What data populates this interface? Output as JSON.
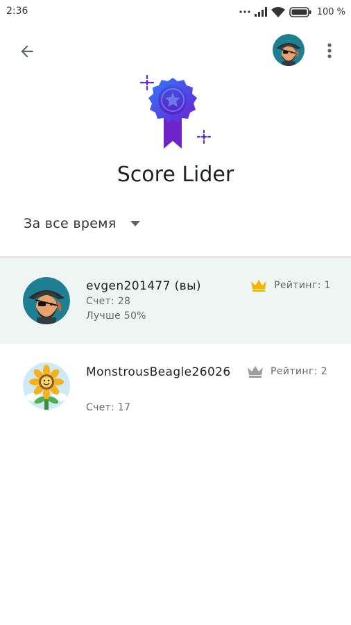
{
  "status_bar": {
    "time": "2:36",
    "battery": "100 %"
  },
  "header": {
    "back_icon": "arrow-back-icon",
    "more_icon": "more-vert-icon"
  },
  "leaderboard": {
    "title": "Score Lider",
    "period": "За все время",
    "badge_icon": "ribbon-star-badge-icon"
  },
  "entries": [
    {
      "name": "evgen201477 (вы)",
      "score": "Счет: 28",
      "best": "Лучше 50%",
      "rating": "Рейтинг: 1",
      "crown_color": "#f4b400",
      "avatar": "pirate-avatar"
    },
    {
      "name": "MonstrousBeagle26026",
      "score": "Счет: 17",
      "rating": "Рейтинг: 2",
      "crown_color": "#9e9e9e",
      "avatar": "sunflower-avatar"
    }
  ],
  "colors": {
    "highlight_row": "#eef5f3",
    "badge_purple": "#5b2bd6",
    "badge_blue": "#2d6bff"
  }
}
